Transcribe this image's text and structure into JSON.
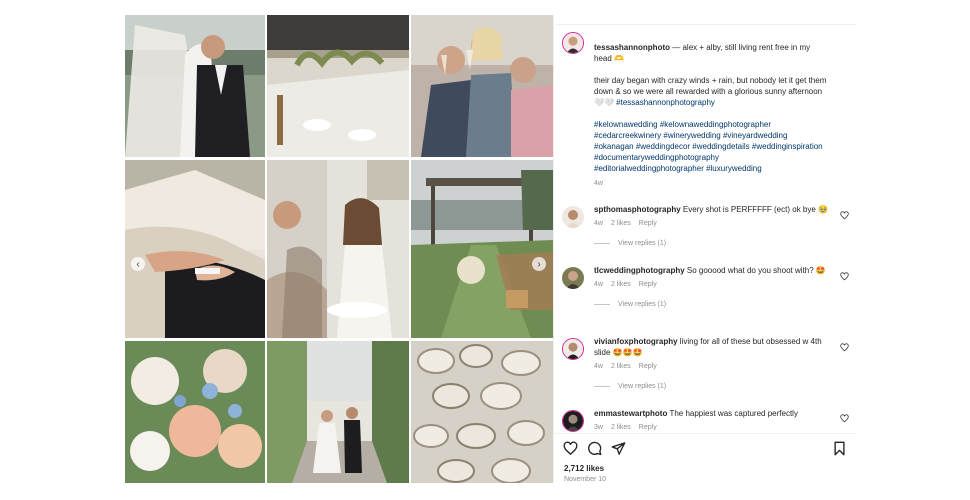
{
  "post": {
    "caption": {
      "username": "tessashannonphoto",
      "line1": " — alex + alby, still living rent free in my head 🫶",
      "line2": "their day began with crazy winds + rain, but nobody let it get them down & so we were all rewarded with a glorious sunny afternoon 🤍🤍 ",
      "line2_tag": "#tessashannonphotography",
      "hashtags": "#kelownawedding #kelownaweddingphotographer #cedarcreekwinery #winerywedding #vineyardwedding #okanagan #weddingdecor #weddingdetails #weddinginspiration #documentaryweddingphotography #editorialweddingphotographer #luxurywedding",
      "age": "4w"
    },
    "comments": [
      {
        "username": "spthomasphotography",
        "text": " Every shot is PERFFFFF (ect) ok bye 🥹",
        "age": "4w",
        "likes": "2 likes",
        "reply": "Reply",
        "view_replies": "View replies (1)"
      },
      {
        "username": "tlcweddingphotography",
        "text": " So gooood what do you shoot with? 🤩",
        "age": "4w",
        "likes": "2 likes",
        "reply": "Reply",
        "view_replies": "View replies (1)"
      },
      {
        "username": "vivianfoxphotography",
        "text": " living for all of these but obsessed w 4th slide 🤩🤩🤩",
        "age": "4w",
        "likes": "2 likes",
        "reply": "Reply",
        "view_replies": "View replies (1)"
      },
      {
        "username": "emmastewartphoto",
        "text": " The happiest was captured perfectly",
        "age": "3w",
        "likes": "2 likes",
        "reply": "Reply",
        "view_replies": ""
      }
    ],
    "likes_count": "2,712 likes",
    "date": "November 10",
    "nav": {
      "prev": "‹",
      "next": "›"
    },
    "icons": [
      "heart-icon",
      "comment-icon",
      "share-icon",
      "bookmark-icon",
      "chevron-left-icon",
      "chevron-right-icon"
    ]
  }
}
